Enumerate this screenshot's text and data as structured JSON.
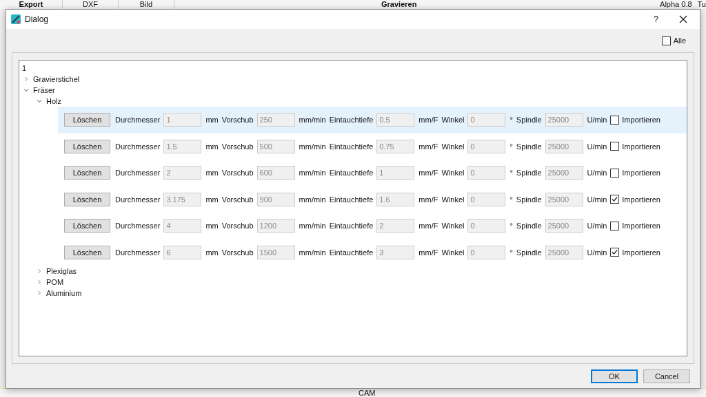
{
  "background_app": {
    "tabs": [
      "Export",
      "DXF",
      "Bild"
    ],
    "title": "Gravieren",
    "version": "Alpha 0.8",
    "edge": "Tu",
    "bottom_tab": "CAM"
  },
  "window": {
    "title": "Dialog",
    "help": "?"
  },
  "alle": {
    "label": "Alle",
    "checked": false
  },
  "tree": {
    "root": "1",
    "children": [
      {
        "label": "Gravierstichel",
        "expanded": false
      },
      {
        "label": "Fräser",
        "expanded": true,
        "children": [
          {
            "label": "Holz",
            "expanded": true,
            "tools": [
              {
                "selected": true,
                "delete": "Löschen",
                "fields": [
                  {
                    "label": "Durchmesser",
                    "value": "1",
                    "unit": "mm"
                  },
                  {
                    "label": "Vorschub",
                    "value": "250",
                    "unit": "mm/min"
                  },
                  {
                    "label": "Eintauchtiefe",
                    "value": "0.5",
                    "unit": "mm/F"
                  },
                  {
                    "label": "Winkel",
                    "value": "0",
                    "unit": "°"
                  },
                  {
                    "label": "Spindle",
                    "value": "25000",
                    "unit": "U/min"
                  }
                ],
                "import_label": "Importieren",
                "import": false
              },
              {
                "selected": false,
                "delete": "Löschen",
                "fields": [
                  {
                    "label": "Durchmesser",
                    "value": "1.5",
                    "unit": "mm"
                  },
                  {
                    "label": "Vorschub",
                    "value": "500",
                    "unit": "mm/min"
                  },
                  {
                    "label": "Eintauchtiefe",
                    "value": "0.75",
                    "unit": "mm/F"
                  },
                  {
                    "label": "Winkel",
                    "value": "0",
                    "unit": "°"
                  },
                  {
                    "label": "Spindle",
                    "value": "25000",
                    "unit": "U/min"
                  }
                ],
                "import_label": "Importieren",
                "import": false
              },
              {
                "selected": false,
                "delete": "Löschen",
                "fields": [
                  {
                    "label": "Durchmesser",
                    "value": "2",
                    "unit": "mm"
                  },
                  {
                    "label": "Vorschub",
                    "value": "600",
                    "unit": "mm/min"
                  },
                  {
                    "label": "Eintauchtiefe",
                    "value": "1",
                    "unit": "mm/F"
                  },
                  {
                    "label": "Winkel",
                    "value": "0",
                    "unit": "°"
                  },
                  {
                    "label": "Spindle",
                    "value": "25000",
                    "unit": "U/min"
                  }
                ],
                "import_label": "Importieren",
                "import": false
              },
              {
                "selected": false,
                "delete": "Löschen",
                "fields": [
                  {
                    "label": "Durchmesser",
                    "value": "3.175",
                    "unit": "mm"
                  },
                  {
                    "label": "Vorschub",
                    "value": "900",
                    "unit": "mm/min"
                  },
                  {
                    "label": "Eintauchtiefe",
                    "value": "1.6",
                    "unit": "mm/F"
                  },
                  {
                    "label": "Winkel",
                    "value": "0",
                    "unit": "°"
                  },
                  {
                    "label": "Spindle",
                    "value": "25000",
                    "unit": "U/min"
                  }
                ],
                "import_label": "Importieren",
                "import": true
              },
              {
                "selected": false,
                "delete": "Löschen",
                "fields": [
                  {
                    "label": "Durchmesser",
                    "value": "4",
                    "unit": "mm"
                  },
                  {
                    "label": "Vorschub",
                    "value": "1200",
                    "unit": "mm/min"
                  },
                  {
                    "label": "Eintauchtiefe",
                    "value": "2",
                    "unit": "mm/F"
                  },
                  {
                    "label": "Winkel",
                    "value": "0",
                    "unit": "°"
                  },
                  {
                    "label": "Spindle",
                    "value": "25000",
                    "unit": "U/min"
                  }
                ],
                "import_label": "Importieren",
                "import": false
              },
              {
                "selected": false,
                "delete": "Löschen",
                "fields": [
                  {
                    "label": "Durchmesser",
                    "value": "6",
                    "unit": "mm"
                  },
                  {
                    "label": "Vorschub",
                    "value": "1500",
                    "unit": "mm/min"
                  },
                  {
                    "label": "Eintauchtiefe",
                    "value": "3",
                    "unit": "mm/F"
                  },
                  {
                    "label": "Winkel",
                    "value": "0",
                    "unit": "°"
                  },
                  {
                    "label": "Spindle",
                    "value": "25000",
                    "unit": "U/min"
                  }
                ],
                "import_label": "Importieren",
                "import": true
              }
            ]
          },
          {
            "label": "Plexiglas",
            "expanded": false
          },
          {
            "label": "POM",
            "expanded": false
          },
          {
            "label": "Aluminium",
            "expanded": false
          }
        ]
      }
    ]
  },
  "buttons": [
    {
      "label": "OK",
      "default": true
    },
    {
      "label": "Cancel",
      "default": false
    }
  ]
}
